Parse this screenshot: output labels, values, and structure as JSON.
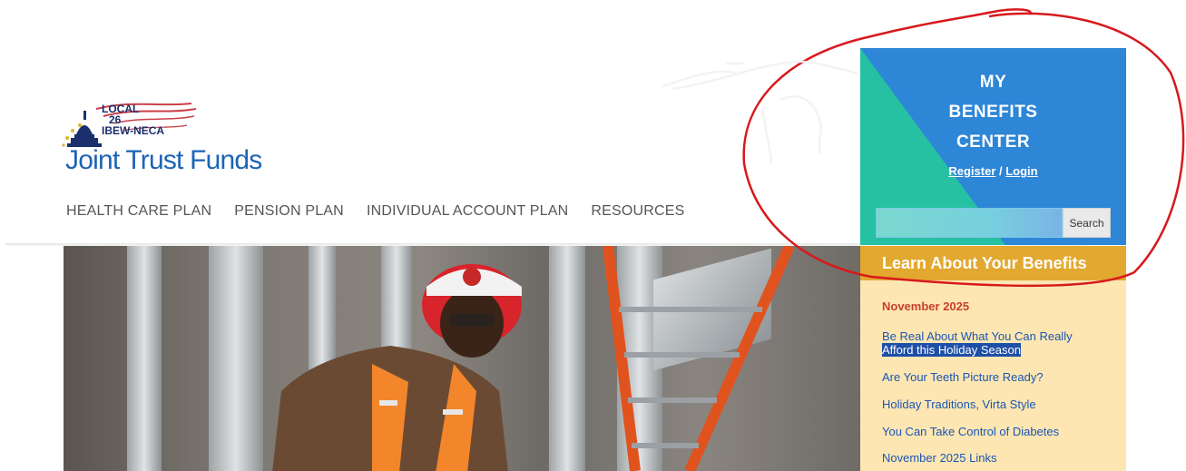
{
  "logo": {
    "local_line1": "LOCAL",
    "local_line2": "26",
    "local_line3": "IBEW-NECA",
    "name": "Joint Trust Funds"
  },
  "nav": {
    "items": [
      {
        "label": "HEALTH CARE PLAN"
      },
      {
        "label": "PENSION PLAN"
      },
      {
        "label": "INDIVIDUAL ACCOUNT PLAN"
      },
      {
        "label": "RESOURCES"
      }
    ]
  },
  "benefits_center": {
    "title_line1": "MY",
    "title_line2": "BENEFITS",
    "title_line3": "CENTER",
    "register_label": "Register",
    "separator": " / ",
    "login_label": "Login",
    "search_placeholder": "",
    "search_button": "Search"
  },
  "learn": {
    "header": "Learn About Your Benefits",
    "month": "November 2025",
    "articles": [
      {
        "line1": "Be Real About What You Can Really",
        "line2": "Afford this Holiday Season"
      },
      {
        "label": "Are Your Teeth Picture Ready?"
      },
      {
        "label": "Holiday Traditions, Virta Style"
      },
      {
        "label": "You Can Take Control of Diabetes"
      },
      {
        "label": "November 2025 Links"
      }
    ]
  },
  "colors": {
    "panel_blue": "#2d86d6",
    "panel_teal": "#26c1a3",
    "learn_header": "#e2a82f",
    "learn_bg": "#fde6b2",
    "month_red": "#c7402c",
    "link_blue": "#1a56b4",
    "annotation_red": "#d7191c"
  },
  "icons": [
    "capitol-dome-icon",
    "stars-icon",
    "flag-stripes-icon"
  ]
}
